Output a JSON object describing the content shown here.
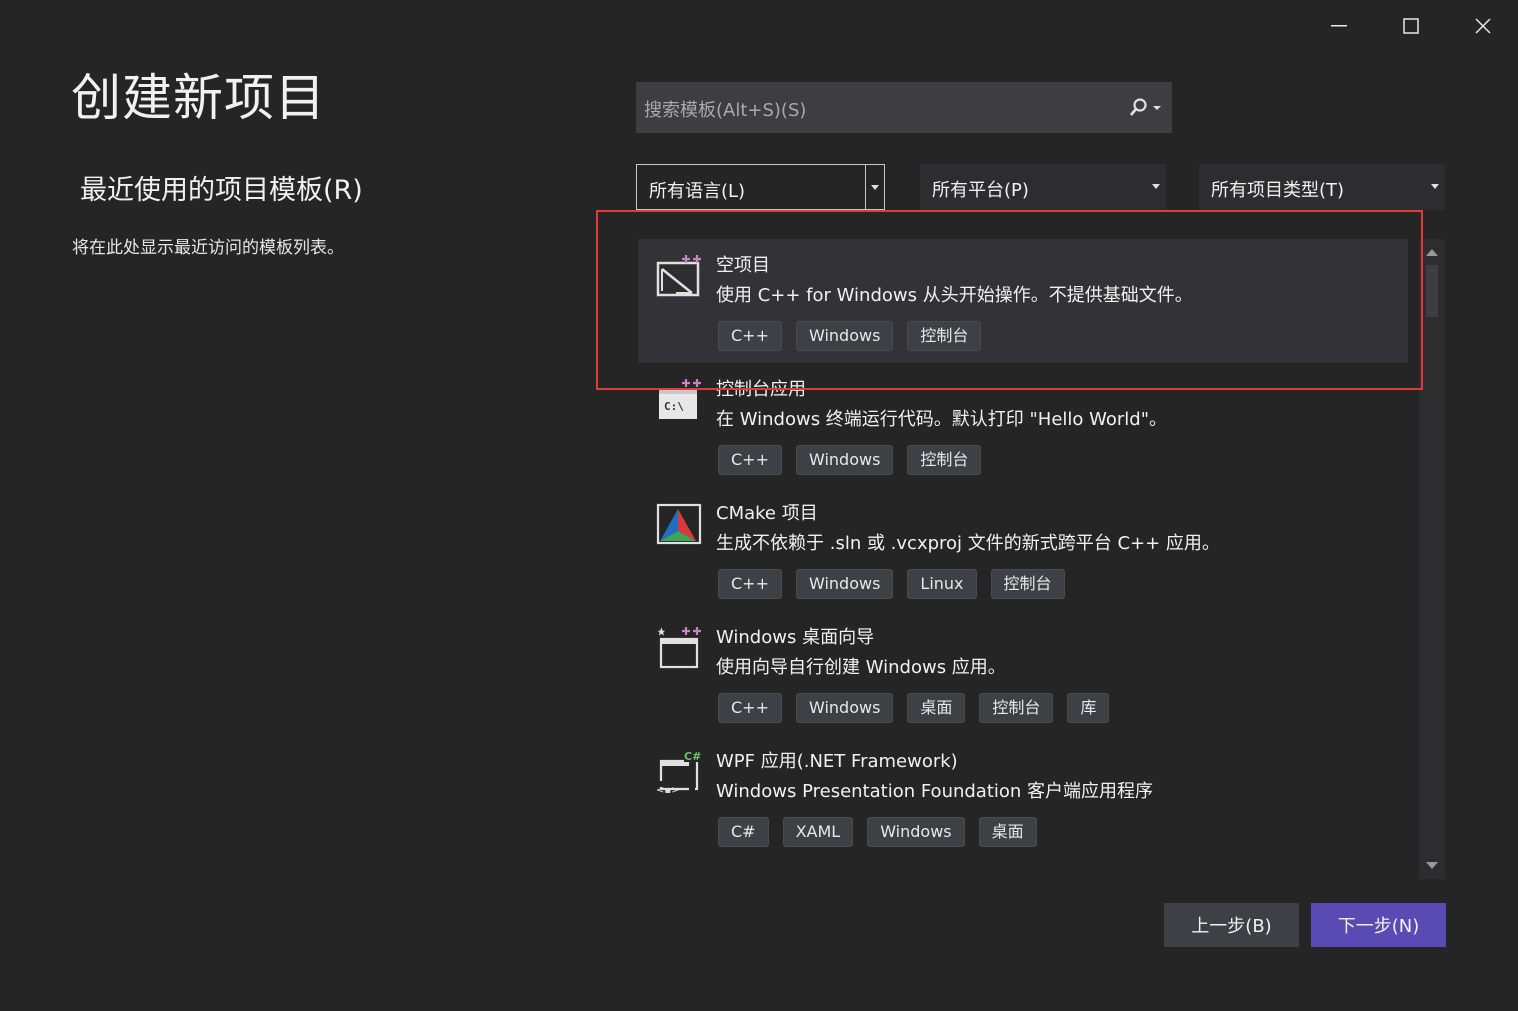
{
  "window": {
    "minimize_glyph": "—",
    "maximize_glyph": "☐",
    "close_glyph": "✕"
  },
  "page": {
    "title": "创建新项目",
    "recent_title": "最近使用的项目模板(R)",
    "recent_empty": "将在此处显示最近访问的模板列表。"
  },
  "search": {
    "placeholder": "搜索模板(Alt+S)(S)",
    "icon": "search-icon"
  },
  "filters": {
    "language": "所有语言(L)",
    "platform": "所有平台(P)",
    "project_type": "所有项目类型(T)"
  },
  "templates": [
    {
      "name": "空项目",
      "description": "使用 C++ for Windows 从头开始操作。不提供基础文件。",
      "tags": [
        "C++",
        "Windows",
        "控制台"
      ],
      "icon": "empty-project-icon",
      "selected": true
    },
    {
      "name": "控制台应用",
      "description": "在 Windows 终端运行代码。默认打印 \"Hello World\"。",
      "tags": [
        "C++",
        "Windows",
        "控制台"
      ],
      "icon": "console-app-icon",
      "selected": false
    },
    {
      "name": "CMake 项目",
      "description": "生成不依赖于 .sln 或 .vcxproj 文件的新式跨平台 C++ 应用。",
      "tags": [
        "C++",
        "Windows",
        "Linux",
        "控制台"
      ],
      "icon": "cmake-icon",
      "selected": false
    },
    {
      "name": "Windows 桌面向导",
      "description": "使用向导自行创建 Windows 应用。",
      "tags": [
        "C++",
        "Windows",
        "桌面",
        "控制台",
        "库"
      ],
      "icon": "desktop-wizard-icon",
      "selected": false
    },
    {
      "name": "WPF 应用(.NET Framework)",
      "description": "Windows Presentation Foundation 客户端应用程序",
      "tags": [
        "C#",
        "XAML",
        "Windows",
        "桌面"
      ],
      "icon": "wpf-app-icon",
      "selected": false
    }
  ],
  "buttons": {
    "back": "上一步(B)",
    "next": "下一步(N)"
  },
  "colors": {
    "background": "#252526",
    "accent_button": "#5a4bb4",
    "highlight_border": "#e03a3a",
    "tag_bg": "#3f3f46"
  }
}
